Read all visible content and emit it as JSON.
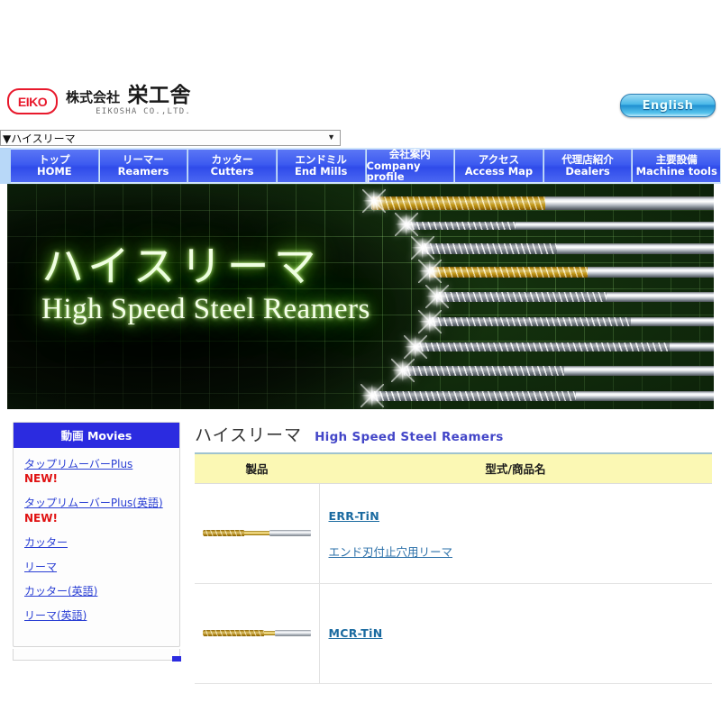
{
  "header": {
    "logo_badge": "EIKO",
    "company_jp_prefix": "株式会社",
    "company_jp_name": "栄工舎",
    "company_en": "EIKOSHA CO.,LTD.",
    "english_button": "English"
  },
  "pulldown": {
    "selected": "▼ハイスリーマ",
    "arrow": "▼"
  },
  "nav": {
    "items": [
      {
        "jp": "トップ",
        "en": "HOME"
      },
      {
        "jp": "リーマー",
        "en": "Reamers"
      },
      {
        "jp": "カッター",
        "en": "Cutters"
      },
      {
        "jp": "エンドミル",
        "en": "End Mills"
      },
      {
        "jp": "会社案内",
        "en": "Company profile"
      },
      {
        "jp": "アクセス",
        "en": "Access Map"
      },
      {
        "jp": "代理店紹介",
        "en": "Dealers"
      },
      {
        "jp": "主要設備",
        "en": "Machine tools"
      }
    ]
  },
  "hero": {
    "title_jp": "ハイスリーマ",
    "title_en": "High Speed Steel Reamers"
  },
  "sidebar": {
    "heading": "動画 Movies",
    "links": [
      {
        "text": "タップリムーバーPlus",
        "badge": "NEW!"
      },
      {
        "text": "タップリムーバーPlus(英語)",
        "badge": "NEW!"
      },
      {
        "text": "カッター",
        "badge": ""
      },
      {
        "text": "リーマ",
        "badge": ""
      },
      {
        "text": "カッター(英語)",
        "badge": ""
      },
      {
        "text": "リーマ(英語)",
        "badge": ""
      }
    ]
  },
  "main": {
    "title_jp": "ハイスリーマ",
    "title_en": "High Speed Steel Reamers",
    "table": {
      "headers": [
        "製品",
        "型式/商品名"
      ],
      "rows": [
        {
          "image_alt": "ERR-TiN reamer",
          "model": "ERR-TiN",
          "description": "エンド刃付止穴用リーマ"
        },
        {
          "image_alt": "MCR-TiN reamer",
          "model": "MCR-TiN",
          "description": ""
        }
      ]
    }
  },
  "colors": {
    "nav_blue": "#3d5bf0",
    "sidebar_head_blue": "#2b2be0",
    "table_header_yellow": "#fbf8b4",
    "link_blue": "#2a3fd4",
    "product_link": "#1a6aa0",
    "hero_green": "#84e03a",
    "logo_red": "#e8192c",
    "title_rule": "#9fc3cf"
  }
}
